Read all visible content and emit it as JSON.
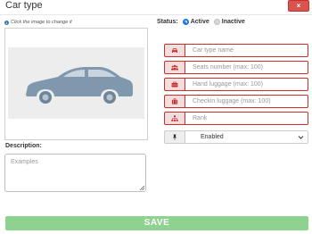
{
  "modal": {
    "title": "Car type",
    "close_label": "×"
  },
  "image_section": {
    "hint": "Click the image to change it"
  },
  "description": {
    "label": "Description:",
    "placeholder": "Examples"
  },
  "status": {
    "label": "Status:",
    "options": [
      {
        "label": "Active",
        "selected": true
      },
      {
        "label": "Inactive",
        "selected": false
      }
    ]
  },
  "fields": [
    {
      "icon": "car-icon",
      "placeholder": "Car type name"
    },
    {
      "icon": "users-icon",
      "placeholder": "Seats number (max: 100)"
    },
    {
      "icon": "briefcase-icon",
      "placeholder": "Hand luggage (max: 100)"
    },
    {
      "icon": "suitcase-icon",
      "placeholder": "Checkin luggage (max: 100)"
    },
    {
      "icon": "sitemap-icon",
      "placeholder": "Rank"
    }
  ],
  "state_select": {
    "icon": "thumbtack-icon",
    "value": "Enabled"
  },
  "footer": {
    "save_label": "SAVE"
  },
  "colors": {
    "danger": "#d9534f",
    "danger_border": "#c9302c",
    "field_addon_bg": "#f2dede",
    "radio_active": "#1a73e8",
    "save_bg": "#8fd18f"
  }
}
